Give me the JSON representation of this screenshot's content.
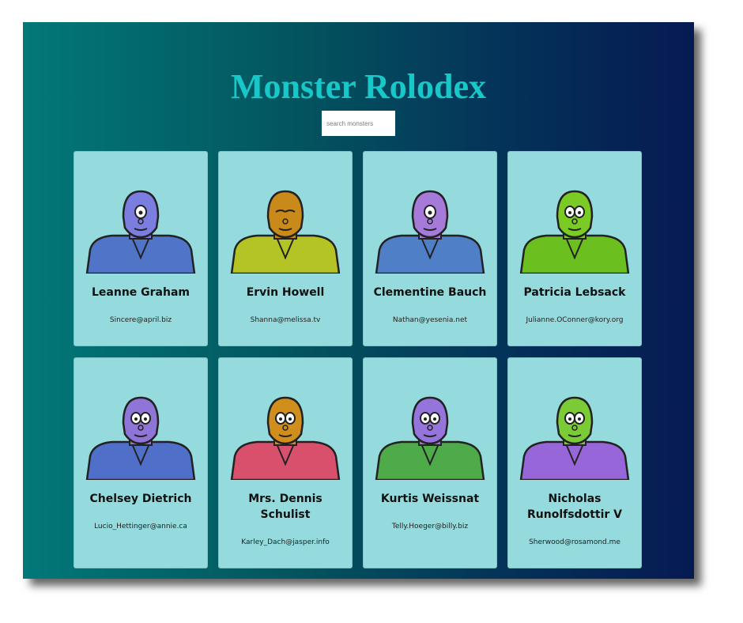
{
  "app": {
    "title": "Monster Rolodex"
  },
  "search": {
    "placeholder": "search monsters",
    "value": ""
  },
  "monsters": [
    {
      "name": "Leanne Graham",
      "email": "Sincere@april.biz",
      "skin": "#7b7ddf",
      "body": "#4f74c8",
      "eye": "one"
    },
    {
      "name": "Ervin Howell",
      "email": "Shanna@melissa.tv",
      "skin": "#c98a1a",
      "body": "#b3c424",
      "eye": "none"
    },
    {
      "name": "Clementine Bauch",
      "email": "Nathan@yesenia.net",
      "skin": "#a57ad8",
      "body": "#4f7fc6",
      "eye": "one"
    },
    {
      "name": "Patricia Lebsack",
      "email": "Julianne.OConner@kory.org",
      "skin": "#7acb23",
      "body": "#6bbf1f",
      "eye": "two"
    },
    {
      "name": "Chelsey Dietrich",
      "email": "Lucio_Hettinger@annie.ca",
      "skin": "#8f75d8",
      "body": "#4f6fc8",
      "eye": "two"
    },
    {
      "name": "Mrs. Dennis Schulist",
      "email": "Karley_Dach@jasper.info",
      "skin": "#d08e1c",
      "body": "#d8506c",
      "eye": "two"
    },
    {
      "name": "Kurtis Weissnat",
      "email": "Telly.Hoeger@billy.biz",
      "skin": "#9574dc",
      "body": "#4faa4a",
      "eye": "two"
    },
    {
      "name": "Nicholas Runolfsdottir V",
      "email": "Sherwood@rosamond.me",
      "skin": "#7acb35",
      "body": "#9766d8",
      "eye": "two"
    }
  ]
}
